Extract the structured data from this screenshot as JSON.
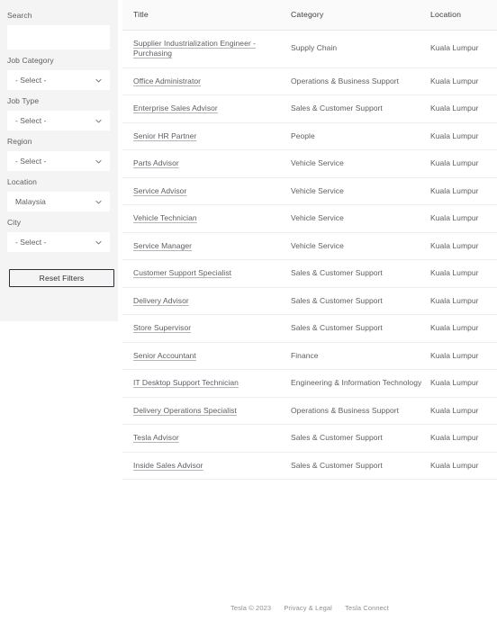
{
  "filters": {
    "search": {
      "label": "Search",
      "value": "",
      "placeholder": ""
    },
    "selects": [
      {
        "label": "Job Category",
        "value": "- Select -"
      },
      {
        "label": "Job Type",
        "value": "- Select -"
      },
      {
        "label": "Region",
        "value": "- Select -"
      },
      {
        "label": "Location",
        "value": "Malaysia"
      },
      {
        "label": "City",
        "value": "- Select -"
      }
    ],
    "reset_label": "Reset Filters"
  },
  "table": {
    "columns": [
      "Title",
      "Category",
      "Location"
    ],
    "rows": [
      {
        "title": "Supplier Industrialization Engineer - Purchasing",
        "category": "Supply Chain",
        "location": "Kuala Lumpur"
      },
      {
        "title": "Office Administrator",
        "category": "Operations & Business Support",
        "location": "Kuala Lumpur"
      },
      {
        "title": "Enterprise Sales Advisor",
        "category": "Sales & Customer Support",
        "location": "Kuala Lumpur"
      },
      {
        "title": "Senior HR Partner",
        "category": "People",
        "location": "Kuala Lumpur"
      },
      {
        "title": "Parts Advisor",
        "category": "Vehicle Service",
        "location": "Kuala Lumpur"
      },
      {
        "title": "Service Advisor",
        "category": "Vehicle Service",
        "location": "Kuala Lumpur"
      },
      {
        "title": "Vehicle Technician",
        "category": "Vehicle Service",
        "location": "Kuala Lumpur"
      },
      {
        "title": "Service Manager",
        "category": "Vehicle Service",
        "location": "Kuala Lumpur"
      },
      {
        "title": "Customer Support Specialist",
        "category": "Sales & Customer Support",
        "location": "Kuala Lumpur"
      },
      {
        "title": "Delivery Advisor",
        "category": "Sales & Customer Support",
        "location": "Kuala Lumpur"
      },
      {
        "title": "Store Supervisor",
        "category": "Sales & Customer Support",
        "location": "Kuala Lumpur"
      },
      {
        "title": "Senior Accountant",
        "category": "Finance",
        "location": "Kuala Lumpur"
      },
      {
        "title": "IT Desktop Support Technician",
        "category": "Engineering & Information Technology",
        "location": "Kuala Lumpur"
      },
      {
        "title": "Delivery Operations Specialist",
        "category": "Operations & Business Support",
        "location": "Kuala Lumpur"
      },
      {
        "title": "Tesla Advisor",
        "category": "Sales & Customer Support",
        "location": "Kuala Lumpur"
      },
      {
        "title": "Inside Sales Advisor",
        "category": "Sales & Customer Support",
        "location": "Kuala Lumpur"
      }
    ]
  },
  "footer": {
    "copyright": "Tesla © 2023",
    "links": [
      "Privacy & Legal",
      "Tesla Connect"
    ]
  },
  "colors": {
    "panel_bg": "#f4f4f4",
    "page_bg": "#ffffff",
    "text_muted": "#5c5e62",
    "header_bg": "#fafafa",
    "border": "#eeeeee",
    "button_border": "#2f3033"
  }
}
